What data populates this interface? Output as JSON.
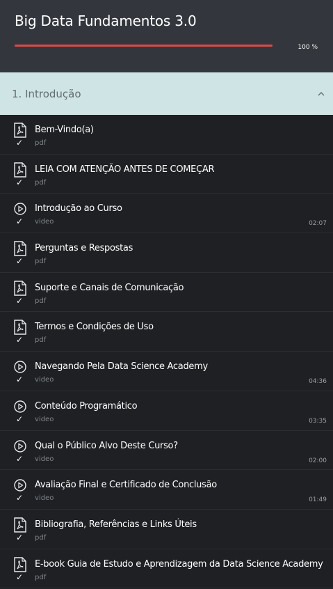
{
  "course": {
    "title": "Big Data Fundamentos 3.0",
    "progress_label": "100 %",
    "progress_fraction": 1.0,
    "progress_color": "#e04848"
  },
  "section": {
    "title": "1. Introdução",
    "expanded": true,
    "collapse_icon": "chevron-up-icon"
  },
  "lessons": [
    {
      "title": "Bem-Vindo(a)",
      "type": "pdf",
      "icon": "pdf-icon",
      "duration": ""
    },
    {
      "title": "LEIA COM ATENÇÃO ANTES DE COMEÇAR",
      "type": "pdf",
      "icon": "pdf-icon",
      "duration": ""
    },
    {
      "title": "Introdução ao Curso",
      "type": "video",
      "icon": "play-circle-icon",
      "duration": "02:07"
    },
    {
      "title": "Perguntas e Respostas",
      "type": "pdf",
      "icon": "pdf-icon",
      "duration": ""
    },
    {
      "title": "Suporte e Canais de Comunicação",
      "type": "pdf",
      "icon": "pdf-icon",
      "duration": ""
    },
    {
      "title": "Termos e Condições de Uso",
      "type": "pdf",
      "icon": "pdf-icon",
      "duration": ""
    },
    {
      "title": "Navegando Pela Data Science Academy",
      "type": "video",
      "icon": "play-circle-icon",
      "duration": "04:36"
    },
    {
      "title": "Conteúdo Programático",
      "type": "video",
      "icon": "play-circle-icon",
      "duration": "03:35"
    },
    {
      "title": "Qual o Público Alvo Deste Curso?",
      "type": "video",
      "icon": "play-circle-icon",
      "duration": "02:00"
    },
    {
      "title": "Avaliação Final e Certificado de Conclusão",
      "type": "video",
      "icon": "play-circle-icon",
      "duration": "01:49"
    },
    {
      "title": "Bibliografia, Referências e Links Úteis",
      "type": "pdf",
      "icon": "pdf-icon",
      "duration": ""
    },
    {
      "title": "E-book Guia de Estudo e Aprendizagem da Data Science Academy",
      "type": "pdf",
      "icon": "pdf-icon",
      "duration": ""
    }
  ],
  "check_glyph": "✓"
}
